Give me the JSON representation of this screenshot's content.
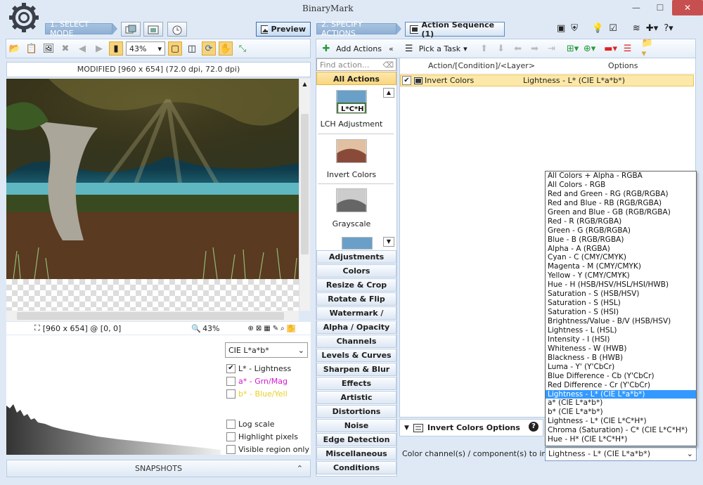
{
  "app": {
    "logo": "BinaryMark"
  },
  "window": {
    "minimize": "—",
    "maximize": "☐",
    "close": "✕"
  },
  "modes": {
    "select_mode": "1. SELECT MODE",
    "specify_actions": "2. SPECIFY ACTIONS",
    "preview_tab": "Preview",
    "action_sequence_tab": "Action Sequence (1)"
  },
  "toolbar": {
    "zoom": "43%"
  },
  "right_toolbar": {
    "add_actions": "Add Actions",
    "collapse": "«",
    "pick_task": "Pick a Task"
  },
  "preview": {
    "title": "MODIFIED [960 x 654] (72.0 dpi, 72.0 dpi)",
    "status_size": "[960 x 654] @ [0, 0]",
    "status_zoom": "43%"
  },
  "histogram": {
    "colorspace": "CIE L*a*b*",
    "channels": [
      {
        "label": "L* - Lightness",
        "checked": true,
        "color": "#222222"
      },
      {
        "label": "a* - Grn/Mag",
        "checked": false,
        "color": "#d01bd0"
      },
      {
        "label": "b* - Blue/Yell",
        "checked": false,
        "color": "#e8d020"
      }
    ],
    "options": [
      {
        "label": "Log scale",
        "checked": false
      },
      {
        "label": "Highlight pixels",
        "checked": false
      },
      {
        "label": "Visible region only",
        "checked": false
      }
    ]
  },
  "snapshots": {
    "label": "SNAPSHOTS",
    "chevron": "⌃"
  },
  "actions": {
    "search_placeholder": "Find action...",
    "all_actions": "All Actions",
    "items": [
      {
        "label": "LCH Adjustment",
        "badge": "L*C*H"
      },
      {
        "label": "Invert Colors"
      },
      {
        "label": "Grayscale"
      }
    ],
    "categories": [
      "Adjustments",
      "Colors",
      "Resize & Crop",
      "Rotate & Flip",
      "Watermark / Overlay",
      "Alpha / Opacity",
      "Channels",
      "Levels & Curves",
      "Sharpen & Blur",
      "Effects",
      "Artistic",
      "Distortions",
      "Noise",
      "Edge Detection",
      "Miscellaneous",
      "Conditions"
    ]
  },
  "sequence": {
    "col_action": "Action/[Condition]/<Layer>",
    "col_options": "Options",
    "rows": [
      {
        "action": "Invert Colors",
        "options": "Lightness - L* (CIE L*a*b*)",
        "checked": true
      }
    ]
  },
  "options_panel": {
    "tab_label": "Invert Colors Options",
    "help": "?",
    "field_label": "Color channel(s) / component(s) to invert:",
    "selected_value": "Lightness - L* (CIE L*a*b*)",
    "dropdown_options": [
      "All Colors + Alpha - RGBA",
      "All Colors - RGB",
      "Red and Green - RG (RGB/RGBA)",
      "Red and Blue - RB (RGB/RGBA)",
      "Green and Blue - GB (RGB/RGBA)",
      "Red - R (RGB/RGBA)",
      "Green - G (RGB/RGBA)",
      "Blue - B (RGB/RGBA)",
      "Alpha - A (RGBA)",
      "Cyan - C (CMY/CMYK)",
      "Magenta - M (CMY/CMYK)",
      "Yellow - Y (CMY/CMYK)",
      "Hue - H (HSB/HSV/HSL/HSI/HWB)",
      "Saturation - S (HSB/HSV)",
      "Saturation - S (HSL)",
      "Saturation - S (HSI)",
      "Brightness/Value - B/V (HSB/HSV)",
      "Lightness - L (HSL)",
      "Intensity - I (HSI)",
      "Whiteness - W (HWB)",
      "Blackness - B (HWB)",
      "Luma - Y' (Y'CbCr)",
      "Blue Difference - Cb (Y'CbCr)",
      "Red Difference - Cr (Y'CbCr)",
      "Lightness - L* (CIE L*a*b*)",
      "a* (CIE L*a*b*)",
      "b* (CIE L*a*b*)",
      "Lightness - L* (CIE L*C*H*)",
      "Chroma (Saturation) - C* (CIE L*C*H*)",
      "Hue - H* (CIE L*C*H*)"
    ],
    "selected_index": 24
  }
}
